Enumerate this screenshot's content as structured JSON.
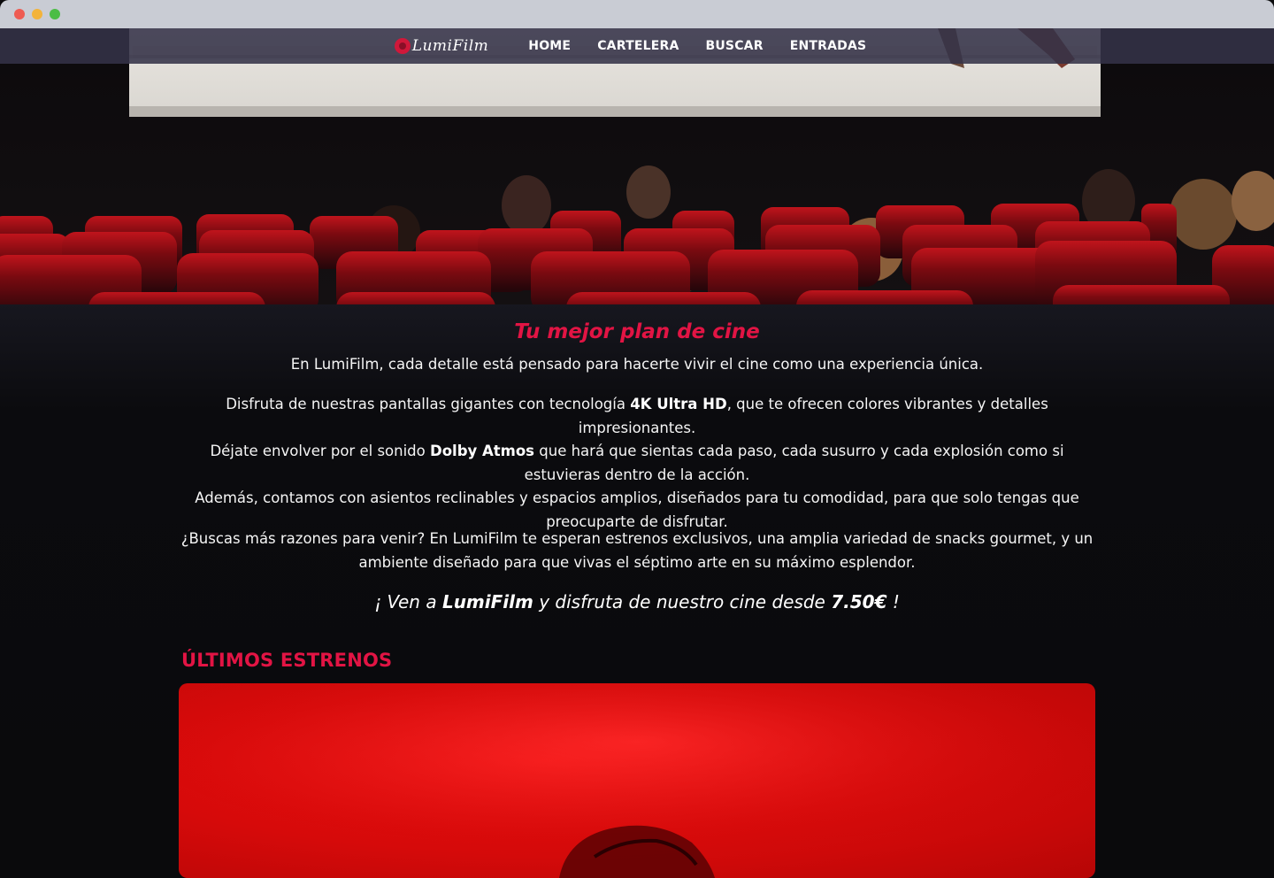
{
  "brand": {
    "name": "LumiFilm"
  },
  "nav": {
    "items": [
      {
        "label": "HOME"
      },
      {
        "label": "CARTELERA"
      },
      {
        "label": "BUSCAR"
      },
      {
        "label": "ENTRADAS"
      }
    ]
  },
  "intro": {
    "tagline": "Tu mejor plan de cine",
    "p1": "En LumiFilm, cada detalle está pensado para hacerte vivir el cine como una experiencia única.",
    "p2_a": "Disfruta de nuestras pantallas gigantes con tecnología ",
    "p2_b": "4K Ultra HD",
    "p2_c": ", que te ofrecen colores vibrantes y detalles impresionantes.",
    "p2_d": "Déjate envolver por el sonido ",
    "p2_e": "Dolby Atmos",
    "p2_f": " que hará que sientas cada paso, cada susurro y cada explosión como si estuvieras dentro de la acción.",
    "p2_g": "Además, contamos con asientos reclinables y espacios amplios, diseñados para tu comodidad, para que solo tengas que preocuparte de disfrutar.",
    "p3": "¿Buscas más razones para venir? En LumiFilm te esperan estrenos exclusivos, una amplia variedad de snacks gourmet, y un ambiente diseñado para que vivas el séptimo arte en su máximo esplendor.",
    "cta_a": "¡ Ven a ",
    "cta_b": "LumiFilm",
    "cta_c": " y disfruta de nuestro cine desde ",
    "cta_d": "7.50€",
    "cta_e": " !"
  },
  "releases": {
    "title": "ÚLTIMOS ESTRENOS"
  },
  "colors": {
    "accent": "#e21444",
    "nav_bg": "#343248",
    "page_bg": "#0a0a0c"
  }
}
